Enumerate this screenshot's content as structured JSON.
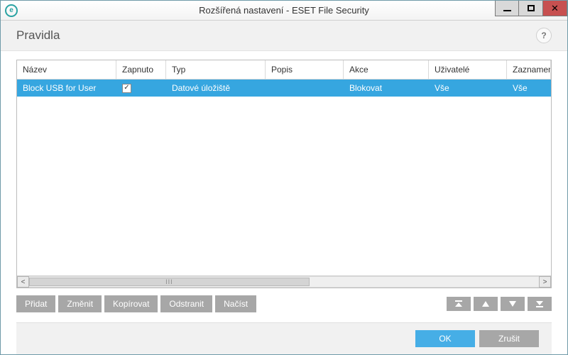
{
  "window": {
    "title": "Rozšířená nastavení - ESET File Security",
    "app_icon_letter": "e"
  },
  "header": {
    "title": "Pravidla",
    "help": "?"
  },
  "table": {
    "columns": {
      "name": "Název",
      "enabled": "Zapnuto",
      "type": "Typ",
      "desc": "Popis",
      "action": "Akce",
      "users": "Uživatelé",
      "log": "Zaznamenávat od úr"
    },
    "rows": [
      {
        "name": "Block USB for User",
        "enabled": true,
        "type": "Datové úložiště",
        "desc": "",
        "action": "Blokovat",
        "users": "Vše",
        "log": "Vše",
        "selected": true
      }
    ]
  },
  "toolbar": {
    "add": "Přidat",
    "edit": "Změnit",
    "copy": "Kopírovat",
    "delete": "Odstranit",
    "load": "Načíst"
  },
  "footer": {
    "ok": "OK",
    "cancel": "Zrušit"
  },
  "scrollbar": {
    "left": "<",
    "right": ">",
    "grip": "III"
  }
}
